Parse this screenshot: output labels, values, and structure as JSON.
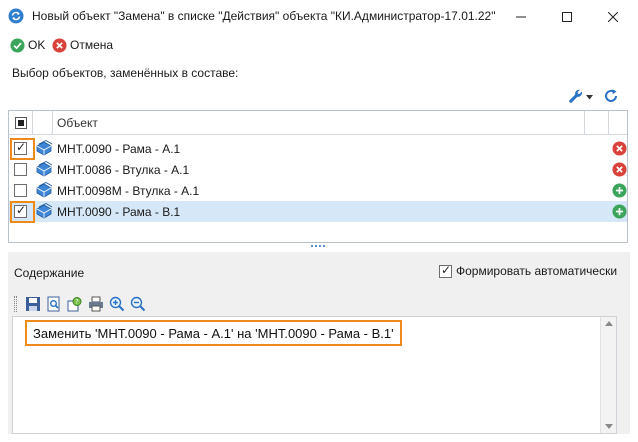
{
  "window": {
    "title": "Новый объект \"Замена\" в списке \"Действия\" объекта \"КИ.Администратор-17.01.22\"",
    "icon": "refresh-circle-icon"
  },
  "toolbar": {
    "ok_label": "OK",
    "cancel_label": "Отмена"
  },
  "selection_label": "Выбор объектов, заменённых в составе:",
  "grid": {
    "column_object": "Объект",
    "rows": [
      {
        "label": "МНТ.0090 - Рама - А.1",
        "checked": true,
        "selected": false,
        "highlighted": true,
        "action": "remove"
      },
      {
        "label": "МНТ.0086 - Втулка - А.1",
        "checked": false,
        "selected": false,
        "highlighted": false,
        "action": "remove"
      },
      {
        "label": "МНТ.0098М - Втулка - А.1",
        "checked": false,
        "selected": false,
        "highlighted": false,
        "action": "add"
      },
      {
        "label": "МНТ.0090 - Рама - В.1",
        "checked": true,
        "selected": true,
        "highlighted": true,
        "action": "add"
      }
    ]
  },
  "content": {
    "label": "Содержание",
    "auto_label": "Формировать автоматически",
    "auto_checked": true,
    "text": "Заменить 'МНТ.0090 - Рама - А.1' на 'МНТ.0090 - Рама - В.1'"
  },
  "colors": {
    "highlight": "#ee8a1a",
    "selected_row": "#d6e8f7",
    "remove": "#d9423a",
    "add": "#3aa55b",
    "ok": "#3aa55b",
    "cancel": "#d9423a"
  }
}
